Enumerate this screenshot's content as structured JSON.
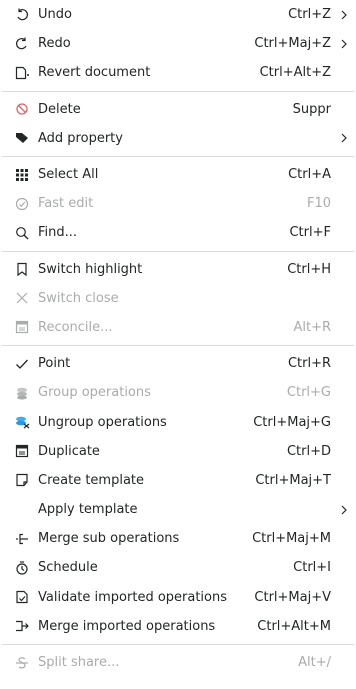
{
  "colors": {
    "text": "#232627",
    "disabled_text": "#a9abac",
    "separator": "#d9dadb",
    "delete_icon": "#e0646a",
    "group_icon": "#3daee9"
  },
  "items": [
    {
      "label": "Undo",
      "shortcut": "Ctrl+Z",
      "icon": "undo-icon",
      "submenu": true,
      "enabled": true
    },
    {
      "label": "Redo",
      "shortcut": "Ctrl+Maj+Z",
      "icon": "redo-icon",
      "submenu": true,
      "enabled": true
    },
    {
      "label": "Revert document",
      "shortcut": "Ctrl+Alt+Z",
      "icon": "revert-document-icon",
      "submenu": false,
      "enabled": true
    },
    {
      "label": "Delete",
      "shortcut": "Suppr",
      "icon": "delete-icon",
      "submenu": false,
      "enabled": true
    },
    {
      "label": "Add property",
      "shortcut": "",
      "icon": "tag-icon",
      "submenu": true,
      "enabled": true
    },
    {
      "label": "Select All",
      "shortcut": "Ctrl+A",
      "icon": "select-all-icon",
      "submenu": false,
      "enabled": true
    },
    {
      "label": "Fast edit",
      "shortcut": "F10",
      "icon": "fast-edit-icon",
      "submenu": false,
      "enabled": false
    },
    {
      "label": "Find...",
      "shortcut": "Ctrl+F",
      "icon": "search-icon",
      "submenu": false,
      "enabled": true
    },
    {
      "label": "Switch highlight",
      "shortcut": "Ctrl+H",
      "icon": "bookmark-icon",
      "submenu": false,
      "enabled": true
    },
    {
      "label": "Switch close",
      "shortcut": "",
      "icon": "close-icon",
      "submenu": false,
      "enabled": false
    },
    {
      "label": "Reconcile...",
      "shortcut": "Alt+R",
      "icon": "reconcile-icon",
      "submenu": false,
      "enabled": false
    },
    {
      "label": "Point",
      "shortcut": "Ctrl+R",
      "icon": "checkmark-icon",
      "submenu": false,
      "enabled": true
    },
    {
      "label": "Group operations",
      "shortcut": "Ctrl+G",
      "icon": "group-icon",
      "submenu": false,
      "enabled": false
    },
    {
      "label": "Ungroup operations",
      "shortcut": "Ctrl+Maj+G",
      "icon": "ungroup-icon",
      "submenu": false,
      "enabled": true
    },
    {
      "label": "Duplicate",
      "shortcut": "Ctrl+D",
      "icon": "duplicate-icon",
      "submenu": false,
      "enabled": true
    },
    {
      "label": "Create template",
      "shortcut": "Ctrl+Maj+T",
      "icon": "create-template-icon",
      "submenu": false,
      "enabled": true
    },
    {
      "label": "Apply template",
      "shortcut": "",
      "icon": "",
      "submenu": true,
      "enabled": true
    },
    {
      "label": "Merge sub operations",
      "shortcut": "Ctrl+Maj+M",
      "icon": "merge-sub-icon",
      "submenu": false,
      "enabled": true
    },
    {
      "label": "Schedule",
      "shortcut": "Ctrl+I",
      "icon": "schedule-icon",
      "submenu": false,
      "enabled": true
    },
    {
      "label": "Validate imported operations",
      "shortcut": "Ctrl+Maj+V",
      "icon": "validate-icon",
      "submenu": false,
      "enabled": true
    },
    {
      "label": "Merge imported operations",
      "shortcut": "Ctrl+Alt+M",
      "icon": "merge-imported-icon",
      "submenu": false,
      "enabled": true
    },
    {
      "label": "Split share...",
      "shortcut": "Alt+/",
      "icon": "split-share-icon",
      "submenu": false,
      "enabled": false
    }
  ]
}
